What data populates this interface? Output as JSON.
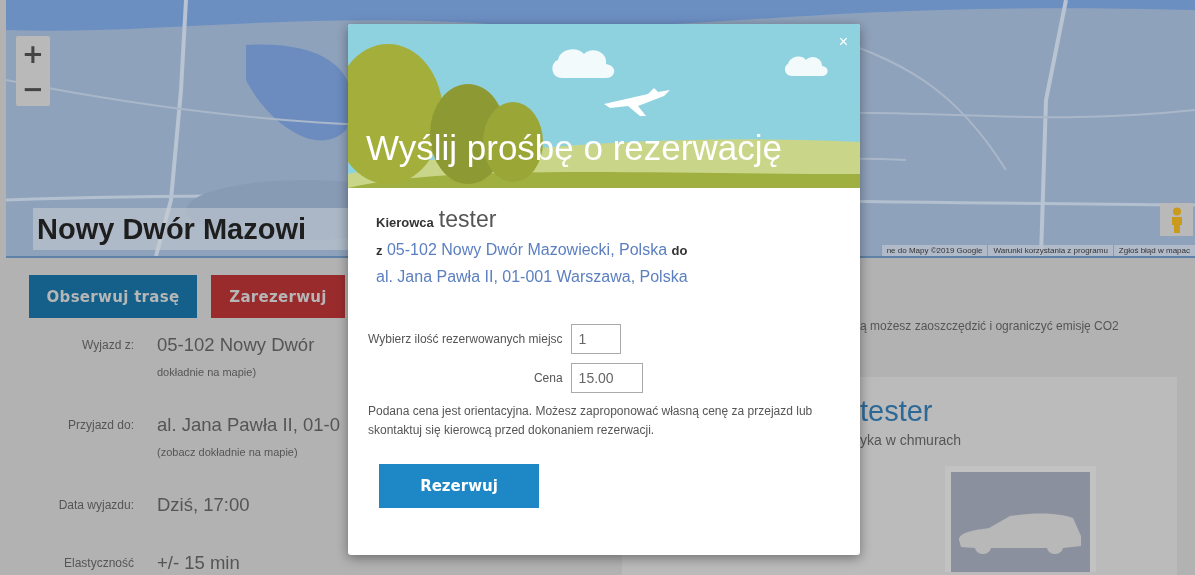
{
  "map": {
    "zoom_controls": [
      "+",
      "−"
    ],
    "place_title": "Nowy Dwór Mazowi",
    "attribution": [
      "ne do Mapy ©2019 Google",
      "Warunki korzystania z programu",
      "Zgłoś błąd w mapac"
    ]
  },
  "actions": [
    {
      "label": "Obserwuj trasę",
      "kind": "primary"
    },
    {
      "label": "Zarezerwuj",
      "kind": "danger"
    }
  ],
  "trip_details": [
    {
      "label": "Wyjazd z:",
      "value": "05-102 Nowy Dwór",
      "note": "dokładnie na mapie)"
    },
    {
      "label": "Przyjazd do:",
      "value": "al. Jana Pawła II, 01-0",
      "note": "(zobacz dokładnie na mapie)"
    },
    {
      "label": "Data wyjazdu:",
      "value": "Dziś, 17:00"
    },
    {
      "label": "Elastyczność",
      "value": "+/- 15 min"
    }
  ],
  "eco_note": "ą możesz zaoszczędzić i ograniczyć emisję CO2",
  "driver_panel": {
    "name": "tester",
    "subtitle": "yka w chmurach"
  },
  "modal": {
    "title": "Wyślij prośbę o rezerwację",
    "close": "×",
    "driver_label": "Kierowca",
    "driver_name": "tester",
    "route": {
      "from_label": "z",
      "from": "05-102 Nowy Dwór Mazowiecki, Polska",
      "to_label": "do",
      "to": "al. Jana Pawła II, 01-001 Warszawa, Polska"
    },
    "fields": [
      {
        "label": "Wybierz ilość rezerwowanych miejsc",
        "value": "1"
      },
      {
        "label": "Cena",
        "value": "15.00"
      }
    ],
    "note": "Podana cena jest orientacyjna. Możesz zaproponować własną cenę za przejazd lub skontaktuj się kierowcą przed dokonaniem rezerwacji.",
    "submit": "Rezerwuj"
  }
}
